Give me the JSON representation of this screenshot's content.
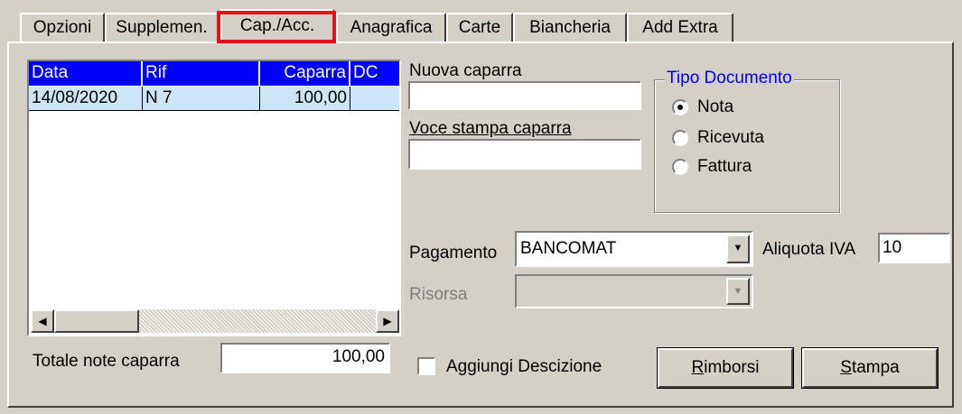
{
  "tabs": [
    {
      "label": "Opzioni"
    },
    {
      "label": "Supplemen."
    },
    {
      "label": "Cap./Acc."
    },
    {
      "label": "Anagrafica"
    },
    {
      "label": "Carte"
    },
    {
      "label": "Biancheria"
    },
    {
      "label": "Add Extra"
    }
  ],
  "active_tab": "Cap./Acc.",
  "grid": {
    "columns": [
      "Data",
      "Rif",
      "Caparra",
      "DC"
    ],
    "rows": [
      {
        "data": "14/08/2020",
        "rif": "N 7",
        "caparra": "100,00",
        "dc": ""
      }
    ]
  },
  "totale": {
    "label": "Totale note caparra",
    "value": "100,00"
  },
  "nuova_caparra": {
    "label": "Nuova caparra",
    "value": ""
  },
  "voce_stampa": {
    "label": "Voce stampa caparra",
    "value": ""
  },
  "tipo_documento": {
    "title": "Tipo Documento",
    "options": [
      "Nota",
      "Ricevuta",
      "Fattura"
    ],
    "selected": "Nota"
  },
  "pagamento": {
    "label": "Pagamento",
    "value": "BANCOMAT"
  },
  "aliquota": {
    "label": "Aliquota IVA",
    "value": "10"
  },
  "risorsa": {
    "label": "Risorsa",
    "value": ""
  },
  "aggiungi": {
    "label": "Aggiungi Descizione",
    "checked": false
  },
  "buttons": {
    "rimborsi_first": "R",
    "rimborsi_rest": "imborsi",
    "stampa_first": "S",
    "stampa_rest": "tampa"
  },
  "colors": {
    "tab_highlight": "#e3131b",
    "grid_header": "#0000ff",
    "grid_row": "#cde6f7",
    "group_title": "#0000ff"
  }
}
